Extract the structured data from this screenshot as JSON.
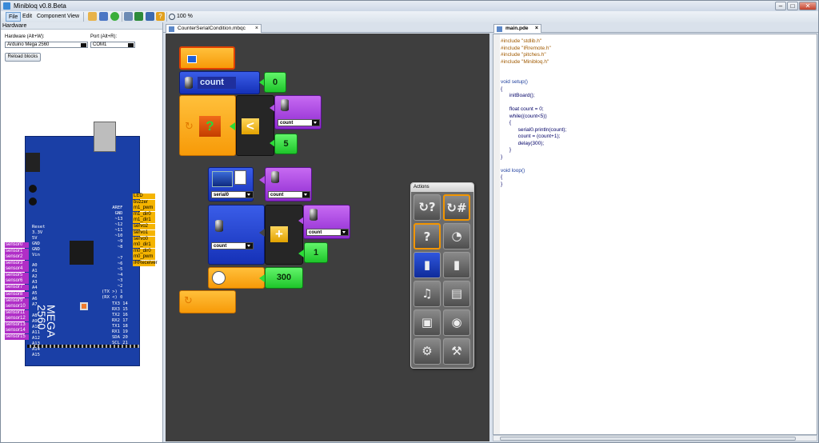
{
  "window": {
    "title": "Minibloq v0.8.Beta",
    "min_label": "–",
    "max_label": "□",
    "close_label": "✕"
  },
  "menu": {
    "items": [
      "File",
      "Edit",
      "Component",
      "View"
    ],
    "zoom": "100 %"
  },
  "hardware": {
    "panel_title": "Hardware",
    "hw_label": "Hardware (Alt+W):",
    "hw_value": "Arduino Mega 2560",
    "port_label": "Port (Alt+R):",
    "port_value": "COM1",
    "reload_label": "Reload blocks",
    "board_model": "MEGA",
    "board_num": "2560",
    "top_pins": "AREF\nGND\n~13\n~12\n~11\n~10\n~9\n~8\n\n~7\n~6\n~5\n~4\n~3\n~2\n(TX >) 1\n(RX <) 0",
    "right_pins": "TX3 14\nRX3 15\nTX2 16\nRX2 17\nTX1 18\nRX1 19\nSDA 20\nSCL 21",
    "power_pins": "Reset\n3.3V\n5V\nGND\nGND\nVin",
    "analog_pins": "A0\nA1\nA2\nA3\nA4\nA5\nA6\nA7\n\nA8\nA9\nA10\nA11\nA12\nA13\nA14\nA15",
    "sensors_a": [
      "sensor0",
      "sensor1",
      "sensor2",
      "sensor3",
      "sensor4",
      "sensor5",
      "sensor6",
      "sensor7"
    ],
    "sensors_b": [
      "sensor8",
      "sensor9",
      "sensor10",
      "sensor11",
      "sensor12",
      "sensor13",
      "sensor14",
      "sensor15"
    ],
    "outputs_a": [
      "LED",
      "buzzer",
      "m1_pwm",
      "m1_dir0",
      "m1_dir1",
      "servo2"
    ],
    "outputs_b": [
      "servo1",
      "servo0",
      "m0_dir1",
      "m0_dir0",
      "m0_pwm",
      "IRReceiver"
    ]
  },
  "canvas": {
    "tab": "CounterSerialCondition.mbqc",
    "var_name": "count",
    "init_value": "0",
    "compare_op": "<",
    "compare_var": "count",
    "compare_value": "5",
    "serial_port": "serial0",
    "print_var": "count",
    "add_var_left": "count",
    "add_var_right": "count",
    "add_op": "+",
    "add_value": "1",
    "delay_value": "300"
  },
  "actions_palette": {
    "title": "Actions"
  },
  "editor": {
    "tab": "main.pde",
    "lines": [
      {
        "t": "#include \"stdlib.h\"",
        "c": "pp"
      },
      {
        "t": "#include \"IRremote.h\"",
        "c": "pp"
      },
      {
        "t": "#include \"pitches.h\"",
        "c": "pp"
      },
      {
        "t": "#include \"Minibloq.h\"",
        "c": "pp"
      },
      {
        "t": "",
        "c": "tx"
      },
      {
        "t": "",
        "c": "tx"
      },
      {
        "t": "void setup()",
        "c": "kw"
      },
      {
        "t": "{",
        "c": "tx"
      },
      {
        "t": "      initBoard();",
        "c": "tx"
      },
      {
        "t": "",
        "c": "tx"
      },
      {
        "t": "      float count = 0;",
        "c": "tx"
      },
      {
        "t": "      while((count<5))",
        "c": "tx"
      },
      {
        "t": "      {",
        "c": "tx"
      },
      {
        "t": "            serial0.println(count);",
        "c": "tx"
      },
      {
        "t": "            count = (count+1);",
        "c": "tx"
      },
      {
        "t": "            delay(300);",
        "c": "tx"
      },
      {
        "t": "      }",
        "c": "tx"
      },
      {
        "t": "}",
        "c": "tx"
      },
      {
        "t": "",
        "c": "tx"
      },
      {
        "t": "void loop()",
        "c": "kw"
      },
      {
        "t": "{",
        "c": "tx"
      },
      {
        "t": "}",
        "c": "tx"
      }
    ]
  }
}
